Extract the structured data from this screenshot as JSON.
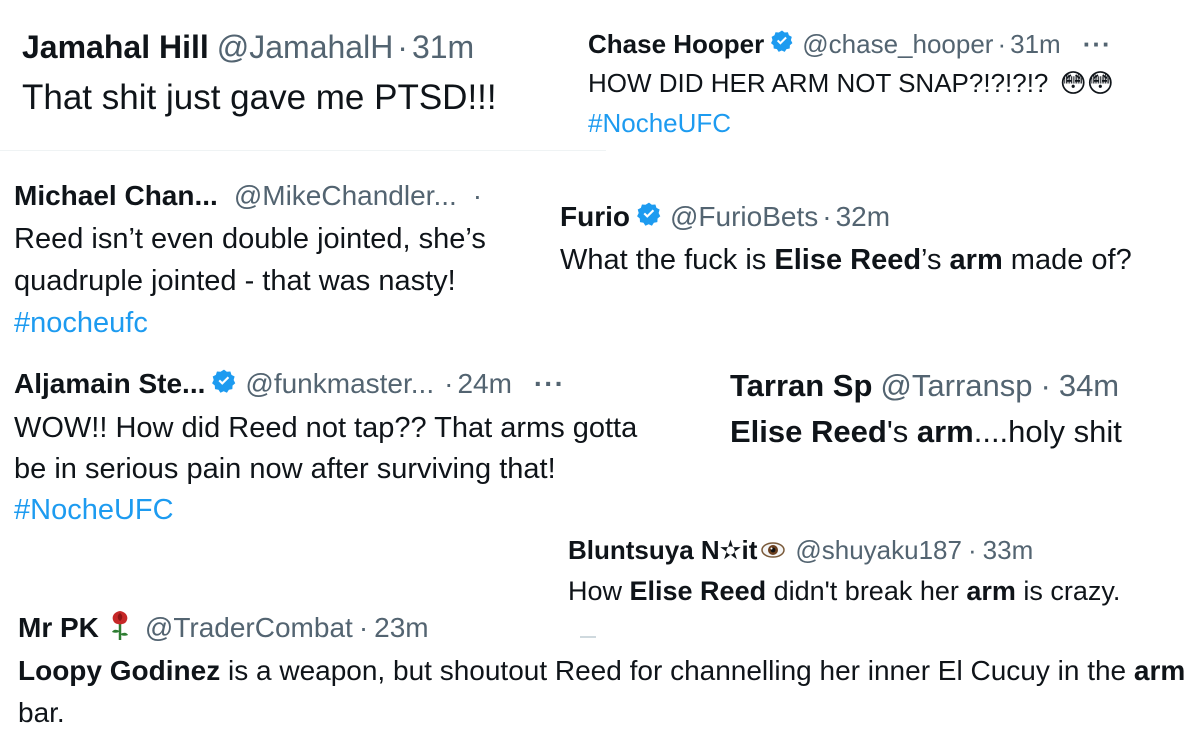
{
  "tweets": [
    {
      "name": "Jamahal Hill",
      "handle": "@JamahalH",
      "sep": "·",
      "time": "31m",
      "body": "That shit just gave me PTSD!!!"
    },
    {
      "name": "Chase Hooper",
      "verified": true,
      "handle": "@chase_hooper",
      "sep": "·",
      "time": "31m",
      "more": "···",
      "body_line1": "HOW DID HER ARM NOT SNAP?!?!?!?",
      "emoji": "😳😳",
      "hashtag": "#NocheUFC"
    },
    {
      "name": "Michael Chan...",
      "handle": "@MikeChandler...",
      "sep": "·",
      "body": "Reed isn’t even double jointed, she’s quadruple jointed - that was nasty!",
      "hashtag": "#nocheufc"
    },
    {
      "name": "Furio",
      "verified": true,
      "handle": "@FurioBets",
      "sep": "·",
      "time": "32m",
      "body_a": "What the fuck is ",
      "body_b": "Elise Reed",
      "body_c": "’s ",
      "body_d": "arm",
      "body_e": " made of?"
    },
    {
      "name": "Aljamain Ste...",
      "verified": true,
      "handle": "@funkmaster...",
      "sep": "·",
      "time": "24m",
      "more": "···",
      "body": "WOW!! How did Reed not tap?? That arms gotta be in serious pain now after surviving that!",
      "hashtag": "#NocheUFC"
    },
    {
      "name": "Tarran Sp",
      "handle": "@Tarransp",
      "sep": "·",
      "time": "34m",
      "body_a": "Elise Reed",
      "body_b": "'s ",
      "body_c": "arm",
      "body_d": "....holy shit"
    },
    {
      "name": "Bluntsuya N✫it",
      "name_icon": "eye-emoji",
      "handle": "@shuyaku187",
      "sep": "·",
      "time": "33m",
      "body_a": "How ",
      "body_b": "Elise Reed",
      "body_c": " didn't break her ",
      "body_d": "arm",
      "body_e": " is crazy."
    },
    {
      "name": "Mr PK",
      "name_icon": "rose-emoji",
      "handle": "@TraderCombat",
      "sep": "·",
      "time": "23m",
      "body_a": "Loopy Godinez",
      "body_b": " is a weapon, but shoutout Reed for channelling her inner El Cucuy in the ",
      "body_c": "arm",
      "body_d": " bar."
    }
  ],
  "colors": {
    "text": "#0f1419",
    "secondary": "#536471",
    "link": "#1d9bf0",
    "verified": "#1d9bf0"
  }
}
